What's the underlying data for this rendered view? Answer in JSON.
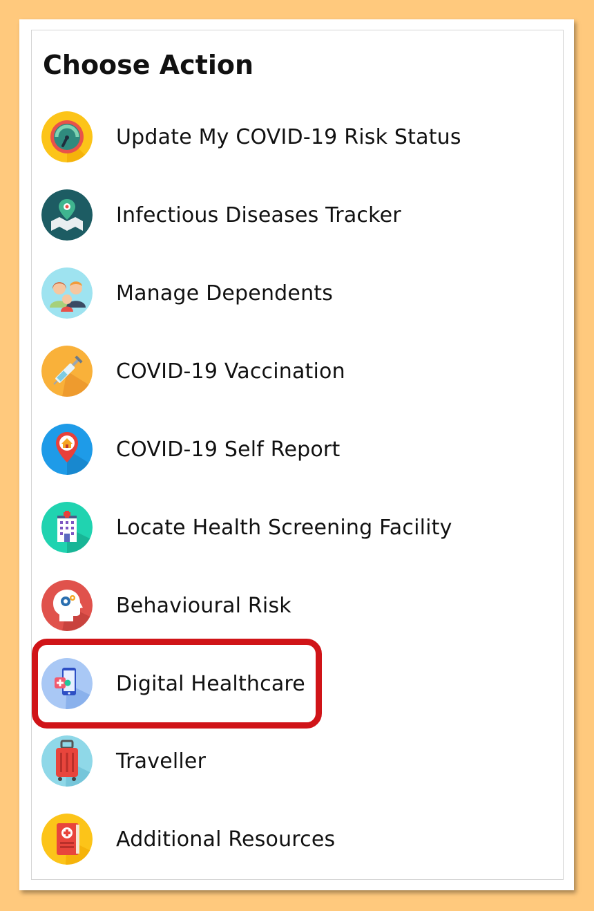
{
  "header": {
    "title": "Choose Action"
  },
  "actions": [
    {
      "label": "Update My COVID-19 Risk Status",
      "icon": "gauge-icon"
    },
    {
      "label": "Infectious Diseases Tracker",
      "icon": "map-pin-icon"
    },
    {
      "label": "Manage Dependents",
      "icon": "family-icon"
    },
    {
      "label": "COVID-19 Vaccination",
      "icon": "syringe-icon"
    },
    {
      "label": "COVID-19 Self Report",
      "icon": "home-pin-icon"
    },
    {
      "label": "Locate Health Screening Facility",
      "icon": "hospital-icon"
    },
    {
      "label": "Behavioural Risk",
      "icon": "head-gear-icon"
    },
    {
      "label": "Digital Healthcare",
      "icon": "phone-health-icon"
    },
    {
      "label": "Traveller",
      "icon": "suitcase-icon"
    },
    {
      "label": "Additional Resources",
      "icon": "medical-book-icon"
    }
  ],
  "highlighted_item": "Digital Healthcare",
  "colors": {
    "background": "#ffc97d",
    "card": "#ffffff",
    "highlight_border": "#d01418",
    "text": "#111111"
  }
}
